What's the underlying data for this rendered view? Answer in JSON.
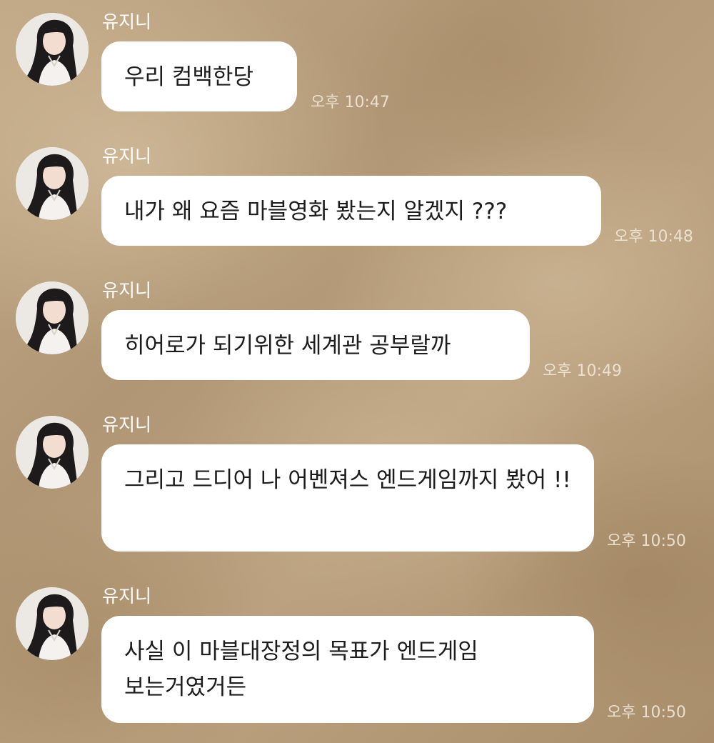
{
  "messages": [
    {
      "sender": "유지니",
      "text": "우리 컴백한당",
      "time": "오후 10:47"
    },
    {
      "sender": "유지니",
      "text": "내가 왜 요즘 마블영화 봤는지 알겠지 ???",
      "time": "오후 10:48"
    },
    {
      "sender": "유지니",
      "text": "히어로가 되기위한 세계관 공부랄까",
      "time": "오후 10:49"
    },
    {
      "sender": "유지니",
      "text": "그리고 드디어 나 어벤져스 엔드게임까지 봤어 !!",
      "time": "오후 10:50"
    },
    {
      "sender": "유지니",
      "text": "사실 이 마블대장정의 목표가 엔드게임 보는거였거든",
      "time": "오후 10:50"
    }
  ],
  "icons": {
    "avatar": "profile-photo-icon"
  },
  "colors": {
    "bubble": "#ffffff",
    "text": "#1c1c1c",
    "sender": "#ffffff",
    "background": "#b49b78"
  }
}
